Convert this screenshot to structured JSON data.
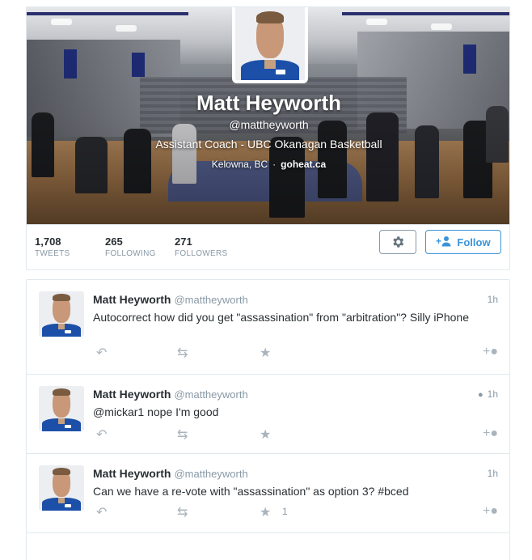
{
  "profile": {
    "name": "Matt Heyworth",
    "handle": "@mattheyworth",
    "bio": "Assistant Coach - UBC Okanagan Basketball",
    "location": "Kelowna, BC",
    "separator": "·",
    "url": "goheat.ca"
  },
  "stats": [
    {
      "value": "1,708",
      "label": "TWEETS"
    },
    {
      "value": "265",
      "label": "FOLLOWING"
    },
    {
      "value": "271",
      "label": "FOLLOWERS"
    }
  ],
  "buttons": {
    "settings_icon": "gear-icon",
    "follow_icon": "follow-person-icon",
    "follow_label": "Follow"
  },
  "tweets": [
    {
      "name": "Matt Heyworth",
      "handle": "@mattheyworth",
      "time": "1h",
      "text": "Autocorrect how did you get \"assassination\" from \"arbitration\"? Silly iPhone",
      "fav_count": ""
    },
    {
      "name": "Matt Heyworth",
      "handle": "@mattheyworth",
      "time": "1h",
      "text": "@mickar1 nope I'm good",
      "fav_count": ""
    },
    {
      "name": "Matt Heyworth",
      "handle": "@mattheyworth",
      "time": "1h",
      "text": "Can we have a re-vote with \"assassination\" as option 3? #bced",
      "fav_count": "1"
    }
  ],
  "colors": {
    "accent": "#3b94d9",
    "muted": "#8899a6",
    "icon": "#a9b4bd",
    "jersey": "#1c4fa8"
  }
}
